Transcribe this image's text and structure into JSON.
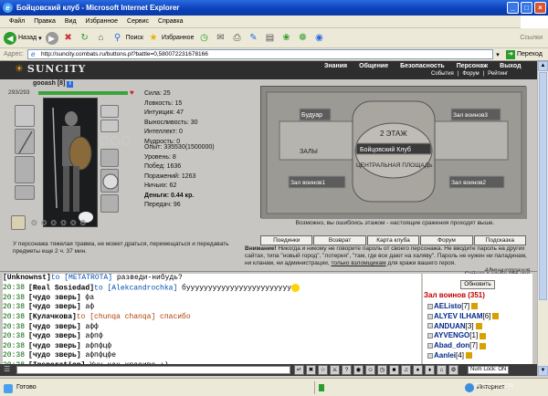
{
  "window": {
    "title": "Бойцовский клуб - Microsoft Internet Explorer",
    "minimize": "_",
    "maximize": "□",
    "close": "×"
  },
  "menu": [
    "Файл",
    "Правка",
    "Вид",
    "Избранное",
    "Сервис",
    "Справка"
  ],
  "toolbar": {
    "back": "Назад",
    "search": "Поиск",
    "favorites": "Избранное",
    "links": "Ссылки"
  },
  "address": {
    "label": "Адрес:",
    "url": "http://suncity.combats.ru/buttons.pl?battle=0,580072231678166",
    "go": "Переход"
  },
  "site": {
    "logo": "SUNCITY",
    "nav": [
      "Знания",
      "Общение",
      "Безопасность",
      "Персонаж",
      "Выход"
    ],
    "subnav": [
      "События",
      "|",
      "Форум",
      "|",
      "Рейтинг"
    ]
  },
  "character": {
    "name": "gooash",
    "level": "[8]",
    "hp": "293/293",
    "stats": [
      "Сила: 25",
      "Ловкость: 15",
      "Интуиция: 47",
      "Выносливость: 30",
      "Интеллект: 0",
      "Мудрость: 0"
    ],
    "stats2": [
      "Опыт: 335530(1500000)",
      "Уровень: 8",
      "Побед: 1636",
      "Поражений: 1263",
      "Ничьих: 62",
      "Деньги: 0.44 кр.",
      "Передач: 96"
    ],
    "trauma": "У персонажа тяжелая травма, не может драться, перемещаться и передавать предметы еще 2 ч. 37 мин."
  },
  "map": {
    "labels": [
      "Будуар",
      "2 ЭТАЖ",
      "Бойцовский Клуб",
      "ЗАЛЫ",
      "ЦЕНТРАЛЬНАЯ ПЛОЩАДЬ",
      "Зал воинов1",
      "Зал воинов2",
      "Зал воинов3"
    ],
    "caption": "Возможно, вы ошиблись этажом - настоящие сражения проходят выше."
  },
  "actions": [
    "Поединки",
    "Возврат",
    "Карта клуба",
    "Форум",
    "Подсказка"
  ],
  "warning": {
    "title": "Внимание!",
    "text": " Никогда и никому не говорите пароль от своего персонажа. Не вводите пароль на других сайтах, типа \"новый город\", \"лотерея\", \"там, где все дают на халяву\". Пароль не нужен ни паладинам, ни кланам, ни администрации, ",
    "link": "только взломщикам",
    "tail": " для кражи вашего героя.",
    "sign": "Администрация."
  },
  "chat": [
    {
      "time": "",
      "nick": "[Unknownst]",
      "to": "to [METATROTA]",
      "msg": " разведи-нибудь?",
      "cut": true
    },
    {
      "time": "20:38",
      "nick": "[Real Sosiedad]",
      "to": "to [Alekcandrochka]",
      "msg": " буууууууууууууууууууууууу",
      "smile": true
    },
    {
      "time": "20:38",
      "nick": "[чудо зверь]",
      "msg": " фа"
    },
    {
      "time": "20:38",
      "nick": "[чудо зверь]",
      "msg": " аф"
    },
    {
      "time": "20:38",
      "nick": "[Кулачкова]",
      "pr": "to [chunqa chanqa] спасибо"
    },
    {
      "time": "20:38",
      "nick": "[чудо зверь]",
      "msg": " афф"
    },
    {
      "time": "20:38",
      "nick": "[чудо зверь]",
      "msg": " афпф"
    },
    {
      "time": "20:38",
      "nick": "[чудо зверь]",
      "msg": " афпфцф"
    },
    {
      "time": "20:38",
      "nick": "[чудо зверь]",
      "msg": " афпфцфе"
    },
    {
      "time": "20:38",
      "nick": "[Insperation]",
      "msg": " Ууу как красиво :)"
    }
  ],
  "online": {
    "text": "Сейчас в клубе 956 чел.",
    "refresh": "Обновить",
    "hall": "Зал воинов (351)",
    "players": [
      {
        "name": "AEListo",
        "level": "[7]"
      },
      {
        "name": "ALYEV ILHAM",
        "level": "[6]"
      },
      {
        "name": "ANDUAN",
        "level": "[3]"
      },
      {
        "name": "AYVENGO",
        "level": "[1]"
      },
      {
        "name": "Abad_don",
        "level": "[7]"
      },
      {
        "name": "Aanlei",
        "level": "[4]"
      }
    ]
  },
  "bottom": {
    "numlock": "Num Lock: ON"
  },
  "status": {
    "ready": "Готово",
    "zone": "Интернет"
  },
  "watermark": "foto.soroks.ru"
}
